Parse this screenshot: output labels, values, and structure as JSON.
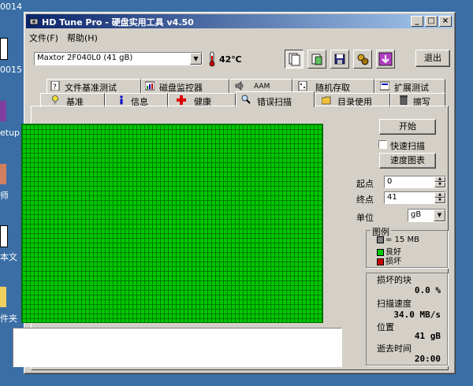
{
  "desktop": {
    "items": [
      {
        "label": "0014"
      },
      {
        "label": "0015"
      },
      {
        "label": "etup"
      },
      {
        "label": "师"
      },
      {
        "label": "本文"
      },
      {
        "label": "件夹"
      }
    ]
  },
  "window": {
    "title": "HD Tune Pro - 硬盘实用工具 v4.50",
    "controls": {
      "minimize": "_",
      "maximize": "□",
      "close": "×"
    }
  },
  "menu": {
    "file": "文件(F)",
    "help": "帮助(H)"
  },
  "toolbar": {
    "drive": "Maxtor 2F040L0 (41 gB)",
    "temperature": "42℃",
    "exit": "退出"
  },
  "tabs": {
    "row_back": [
      {
        "label": "文件基准测试",
        "icon": "file-benchmark-icon"
      },
      {
        "label": "磁盘监控器",
        "icon": "disk-monitor-icon"
      },
      {
        "label": "AAM",
        "icon": "speaker-icon"
      },
      {
        "label": "随机存取",
        "icon": "random-access-icon"
      },
      {
        "label": "扩展测试",
        "icon": "extra-tests-icon"
      }
    ],
    "row_front": [
      {
        "label": "基准",
        "icon": "benchmark-icon"
      },
      {
        "label": "信息",
        "icon": "info-icon"
      },
      {
        "label": "健康",
        "icon": "health-cross-icon"
      },
      {
        "label": "错误扫描",
        "icon": "error-scan-icon",
        "active": true
      },
      {
        "label": "目录使用",
        "icon": "folder-icon"
      },
      {
        "label": "擦写",
        "icon": "erase-icon"
      }
    ]
  },
  "scan": {
    "start_button": "开始",
    "quick_scan": "快速扫描",
    "quick_scan_checked": false,
    "speed_map_button": "速度图表",
    "start_label": "起点",
    "start_value": "0",
    "end_label": "终点",
    "end_value": "41",
    "unit_label": "单位",
    "unit_value": "gB"
  },
  "legend": {
    "title": "图例",
    "block_size": "= 15 MB",
    "good": "良好",
    "bad": "损坏",
    "colors": {
      "block": "#808080",
      "good": "#00c800",
      "bad": "#c80000"
    }
  },
  "stats": {
    "damaged_label": "损坏的块",
    "damaged_value": "0.0 %",
    "speed_label": "扫描速度",
    "speed_value": "34.0 MB/s",
    "position_label": "位置",
    "position_value": "41 gB",
    "elapsed_label": "逝去时间",
    "elapsed_value": "20:00"
  }
}
